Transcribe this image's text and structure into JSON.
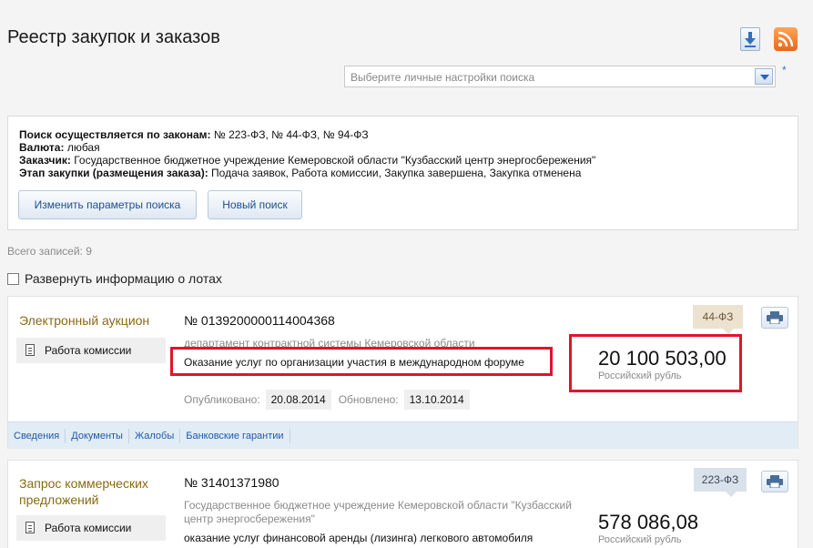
{
  "header": {
    "title": "Реестр закупок и заказов",
    "settings_placeholder": "Выберите личные настройки поиска",
    "star": "*"
  },
  "search_criteria": {
    "laws_label": "Поиск осуществляется по законам:",
    "laws_value": "№ 223-ФЗ, № 44-ФЗ, № 94-ФЗ",
    "currency_label": "Валюта:",
    "currency_value": "любая",
    "customer_label": "Заказчик:",
    "customer_value": "Государственное бюджетное учреждение Кемеровской области \"Кузбасский центр энергосбережения\"",
    "stage_label": "Этап закупки (размещения заказа):",
    "stage_value": "Подача заявок, Работа комиссии, Закупка завершена, Закупка отменена",
    "change_button": "Изменить параметры поиска",
    "new_search_button": "Новый поиск"
  },
  "results": {
    "total_label": "Всего записей: 9",
    "expand_label": "Развернуть информацию о лотах"
  },
  "records": [
    {
      "type": "Электронный аукцион",
      "status": "Работа комиссии",
      "number": "№ 0139200000114004368",
      "organization": "департамент контрактной системы Кемеровской области",
      "subject": "Оказание услуг по организации участия в международном форуме",
      "price": "20 100 503,00",
      "currency": "Российский рубль",
      "law": "44-ФЗ",
      "published_label": "Опубликовано:",
      "published_date": "20.08.2014",
      "updated_label": "Обновлено:",
      "updated_date": "13.10.2014",
      "tabs": [
        "Сведения",
        "Документы",
        "Жалобы",
        "Банковские гарантии"
      ]
    },
    {
      "type_line1": "Запрос коммерческих",
      "type_line2": "предложений",
      "status": "Работа комиссии",
      "number": "№ 31401371980",
      "organization_line1": "Государственное бюджетное учреждение Кемеровской области \"Кузбасский",
      "organization_line2": "центр энергосбережения\"",
      "subject": "оказание услуг финансовой аренды (лизинга) легкового автомобиля",
      "price": "578 086,08",
      "currency": "Российский рубль",
      "law": "223-ФЗ"
    }
  ],
  "colors": {
    "highlight": "#e0142a",
    "type_text": "#8a6a12",
    "link": "#1f5aa6"
  }
}
